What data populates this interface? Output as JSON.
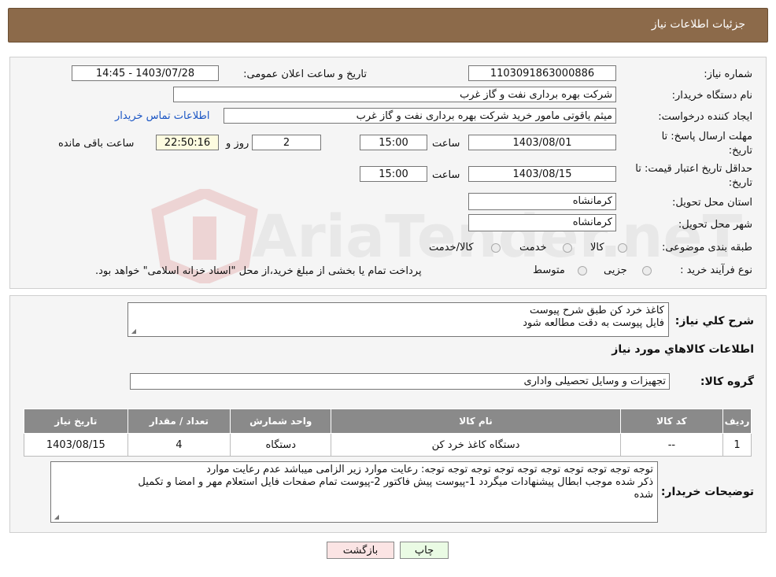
{
  "header": {
    "title": "جزئیات اطلاعات نیاز"
  },
  "info": {
    "need_number_label": "شماره نیاز:",
    "need_number": "1103091863000886",
    "announce_label": "تاریخ و ساعت اعلان عمومی:",
    "announce_value": "1403/07/28 - 14:45",
    "buyer_org_label": "نام دستگاه خریدار:",
    "buyer_org": "شرکت بهره برداری نفت و گاز غرب",
    "requester_label": "ایجاد کننده درخواست:",
    "requester": "میثم یاقوتی مامور خرید شرکت بهره برداری نفت و گاز غرب",
    "contact_link": "اطلاعات تماس خریدار",
    "deadline_label_1": "مهلت ارسال پاسخ: تا",
    "deadline_label_2": "تاریخ:",
    "deadline_date": "1403/08/01",
    "time_label": "ساعت",
    "deadline_time": "15:00",
    "days_value": "2",
    "days_label": "روز و",
    "remaining_time": "22:50:16",
    "remaining_label": "ساعت باقی مانده",
    "validity_label_1": "حداقل تاریخ اعتبار قیمت: تا",
    "validity_label_2": "تاریخ:",
    "validity_date": "1403/08/15",
    "validity_time": "15:00",
    "province_label": "استان محل تحویل:",
    "province": "کرمانشاه",
    "city_label": "شهر محل تحویل:",
    "city": "کرمانشاه",
    "category_label": "طبقه بندی موضوعی:",
    "category_options": [
      "کالا",
      "خدمت",
      "کالا/خدمت"
    ],
    "process_label": "نوع فرآیند خرید :",
    "process_options": [
      "جزیی",
      "متوسط"
    ],
    "process_note": "پرداخت تمام یا بخشی از مبلغ خرید،از محل \"اسناد خزانه اسلامی\" خواهد بود."
  },
  "summary": {
    "label": "شرح کلي نياز:",
    "lines": [
      "کاغذ خرد کن طبق شرح پیوست",
      "فایل پیوست به دقت مطالعه شود"
    ]
  },
  "goods": {
    "section_title": "اطلاعات کالاهاي مورد نياز",
    "group_label": "گروه کالا:",
    "group_value": "تجهیزات و وسایل تحصیلی واداری",
    "columns": [
      "ردیف",
      "کد کالا",
      "نام کالا",
      "واحد شمارش",
      "تعداد / مقدار",
      "تاریخ نیاز"
    ],
    "rows": [
      {
        "row": "1",
        "code": "--",
        "name": "دستگاه کاغذ خرد کن",
        "unit": "دستگاه",
        "qty": "4",
        "date": "1403/08/15"
      }
    ]
  },
  "buyer_notes": {
    "label": "توضیحات خریدار:",
    "lines": [
      "توجه توجه توجه توجه توجه توجه توجه توجه توجه توجه: رعایت موارد زیر الزامی میباشد عدم رعایت موارد",
      "ذکر شده موجب ابطال پیشنهادات میگردد 1-پیوست پیش فاکتور 2-پیوست تمام صفحات  فایل استعلام مهر و امضا و تکمیل",
      "شده"
    ]
  },
  "buttons": {
    "print": "چاپ",
    "back": "بازگشت"
  },
  "watermark": {
    "text": "AriaTender.neT"
  },
  "colors": {
    "header": "#8c6a4a",
    "table_header": "#8a8a8a",
    "link": "#1a55c4",
    "print_btn": "#eafbe4",
    "back_btn": "#fbe4e4"
  }
}
